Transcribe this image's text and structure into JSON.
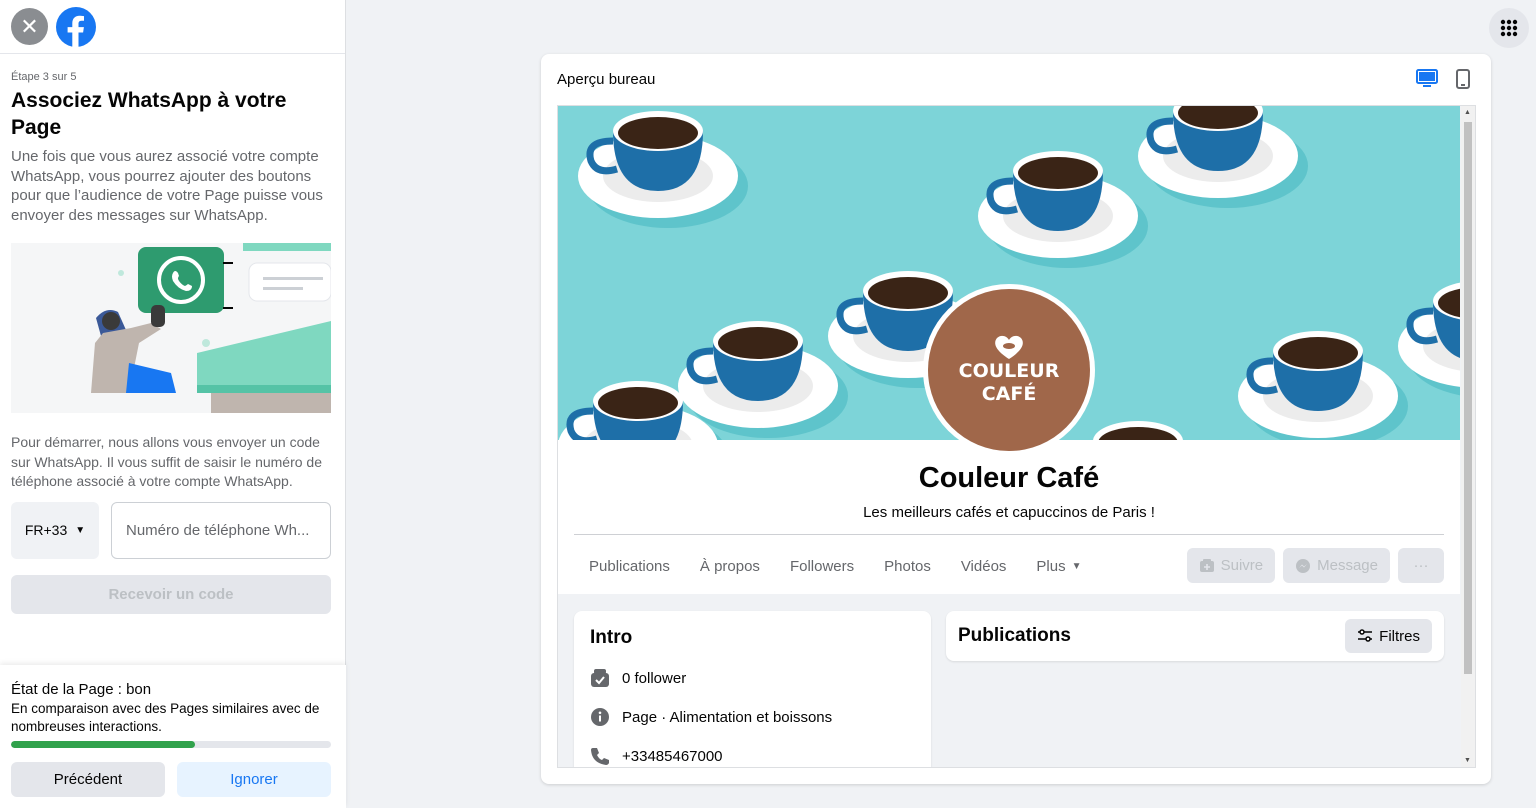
{
  "left_panel": {
    "step": "Étape 3 sur 5",
    "title": "Associez WhatsApp à votre Page",
    "description": "Une fois que vous aurez associé votre compte WhatsApp, vous pourrez ajouter des boutons pour que l’audience de votre Page puisse vous envoyer des messages sur WhatsApp.",
    "help_text": "Pour démarrer, nous allons vous envoyer un code sur WhatsApp. Il vous suffit de saisir le numéro de téléphone associé à votre compte WhatsApp.",
    "country_code": "FR+33",
    "phone_placeholder": "Numéro de téléphone Wh...",
    "phone_value": "",
    "receive_code_button": "Recevoir un code",
    "page_state": {
      "title": "État de la Page : bon",
      "description": "En comparaison avec des Pages similaires avec de nombreuses interactions.",
      "progress": 0.575
    },
    "previous_button": "Précédent",
    "ignore_button": "Ignorer"
  },
  "preview": {
    "title": "Aperçu bureau",
    "page_name": "Couleur Café",
    "tagline": "Les meilleurs cafés et capuccinos de Paris !",
    "logo_line1": "COULEUR",
    "logo_line2": "CAFÉ",
    "tabs": [
      "Publications",
      "À propos",
      "Followers",
      "Photos",
      "Vidéos",
      "Plus"
    ],
    "actions": {
      "follow": "Suivre",
      "message": "Message",
      "more": "···"
    },
    "intro": {
      "title": "Intro",
      "followers": "0 follower",
      "category_label": "Page",
      "category": " · Alimentation et boissons",
      "phone": "+33485467000"
    },
    "posts": {
      "title": "Publications",
      "filters": "Filtres"
    }
  },
  "colors": {
    "accent": "#1877f2",
    "progress": "#31a24c",
    "cover": "#7dd4d8",
    "logo_bg": "#a0674a"
  }
}
